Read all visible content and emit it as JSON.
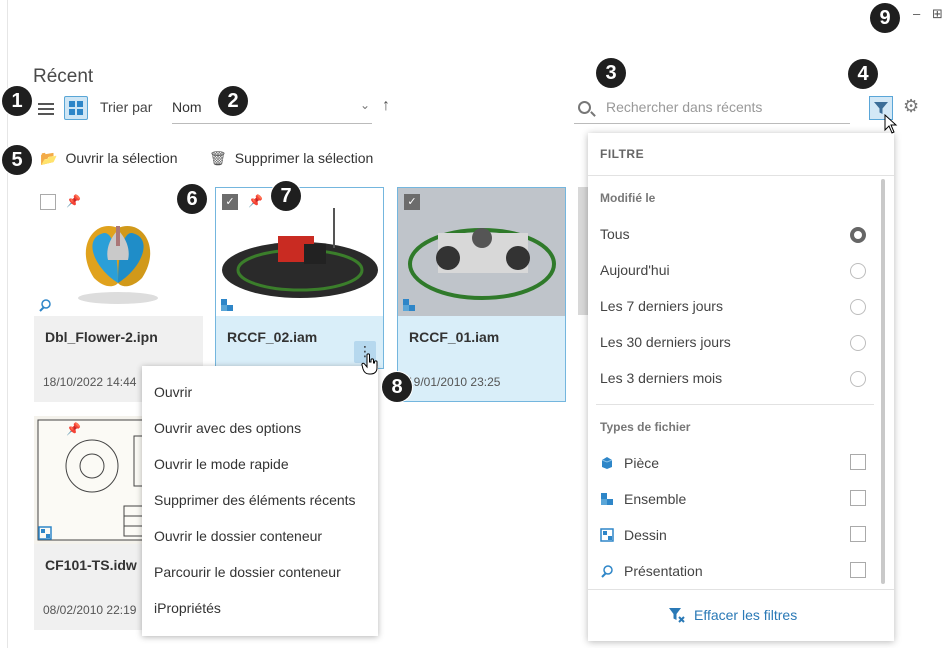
{
  "window": {
    "minimize_label": "–",
    "restore_label": "⊞"
  },
  "page": {
    "title": "Récent"
  },
  "toolbar": {
    "sort_label": "Trier par",
    "sort_value": "Nom",
    "search_placeholder": "Rechercher dans récents"
  },
  "actions": {
    "open_selection": "Ouvrir la sélection",
    "delete_selection": "Supprimer la sélection"
  },
  "files": [
    {
      "name": "Dbl_Flower-2.ipn",
      "date": "18/10/2022 14:44",
      "type": "presentation",
      "selected": false
    },
    {
      "name": "RCCF_02.iam",
      "date": "",
      "type": "assembly",
      "selected": true
    },
    {
      "name": "RCCF_01.iam",
      "date": "19/01/2010 23:25",
      "type": "assembly",
      "selected": true
    },
    {
      "name": "CF101-TS.idw",
      "date": "08/02/2010 22:19",
      "type": "drawing",
      "selected": false
    }
  ],
  "context_menu": [
    "Ouvrir",
    "Ouvrir avec des options",
    "Ouvrir le mode rapide",
    "Supprimer des éléments récents",
    "Ouvrir le dossier conteneur",
    "Parcourir le dossier conteneur",
    "iPropriétés"
  ],
  "filter": {
    "header": "FILTRE",
    "modified_section": "Modifié le",
    "modified_options": [
      "Tous",
      "Aujourd'hui",
      "Les 7 derniers jours",
      "Les 30 derniers jours",
      "Les 3 derniers mois"
    ],
    "selected_modified": "Tous",
    "types_section": "Types de fichier",
    "types": [
      "Pièce",
      "Ensemble",
      "Dessin",
      "Présentation"
    ],
    "clear_label": "Effacer les filtres"
  },
  "callouts": [
    "1",
    "2",
    "3",
    "4",
    "5",
    "6",
    "7",
    "8",
    "9"
  ],
  "colors": {
    "accent": "#2e86c8",
    "selected_bg": "#d9eef9",
    "badge": "#1f1f1f"
  }
}
